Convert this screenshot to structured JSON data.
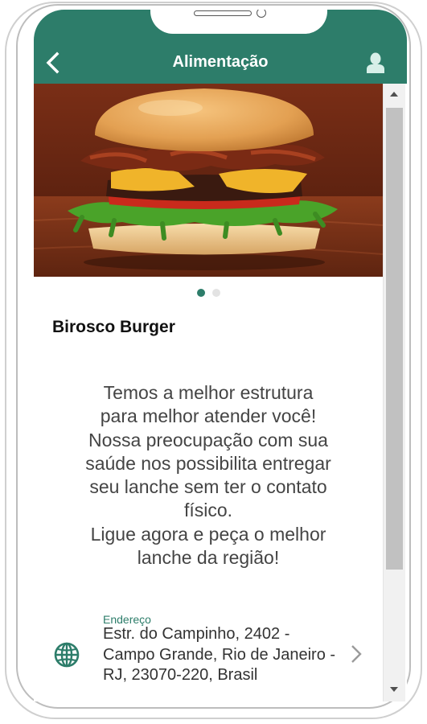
{
  "header": {
    "title": "Alimentação"
  },
  "carousel": {
    "image_description_icon": "burger-photo",
    "slide_count": 2,
    "active_slide": 1
  },
  "venue": {
    "name": "Birosco Burger",
    "description": "Temos a melhor estrutura\npara melhor atender você!\nNossa preocupação com sua\nsaúde nos possibilita entregar\nseu lanche sem ter o contato\nfísico.\nLigue agora e peça o melhor\nlanche da região!"
  },
  "address": {
    "label": "Endereço",
    "value": "Estr. do Campinho, 2402 - Campo Grande, Rio de Janeiro - RJ, 23070-220, Brasil"
  },
  "icons": {
    "back": "chevron-left-icon",
    "profile": "user-icon",
    "address": "globe-icon",
    "address_action": "chevron-right-icon"
  },
  "colors": {
    "brand": "#2d7d6a",
    "header_text": "#ffffff",
    "body_text": "#444444"
  }
}
